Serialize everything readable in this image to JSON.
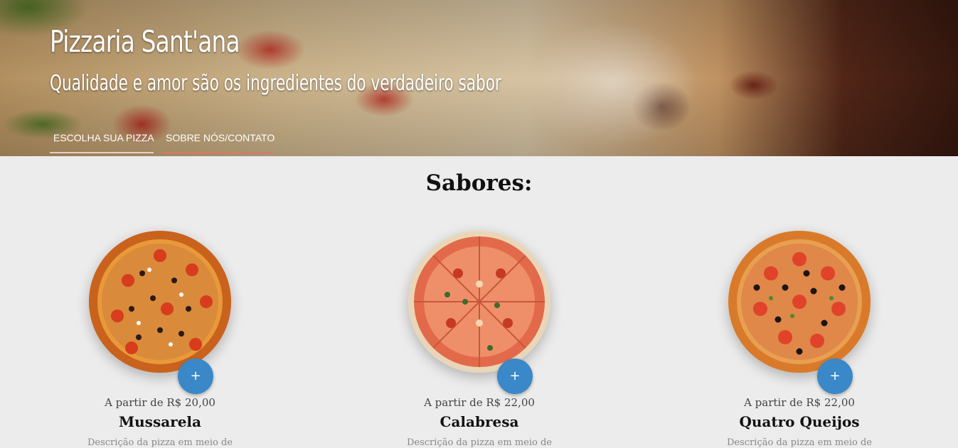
{
  "header": {
    "title": "Pizzaria Sant'ana",
    "tagline": "Qualidade e amor são os ingredientes do verdadeiro sabor",
    "nav": [
      {
        "label": "ESCOLHA SUA PIZZA"
      },
      {
        "label": "SOBRE NÓS/CONTATO"
      }
    ]
  },
  "main": {
    "section_title": "Sabores:",
    "pizzas": [
      {
        "name": "Mussarela",
        "price": "A partir de R$ 20,00",
        "add_label": "+",
        "description": "Descrição da pizza em meio de",
        "image": "pizza-mussarela-image"
      },
      {
        "name": "Calabresa",
        "price": "A partir de R$ 22,00",
        "add_label": "+",
        "description": "Descrição da pizza em meio de",
        "image": "pizza-calabresa-image"
      },
      {
        "name": "Quatro Queijos",
        "price": "A partir de R$ 22,00",
        "add_label": "+",
        "description": "Descrição da pizza em meio de",
        "image": "pizza-quatro-queijos-image"
      }
    ]
  },
  "colors": {
    "accent": "#3a88c8",
    "background": "#ececec",
    "nav_underline_active": "#e9cfc6",
    "nav_underline": "#d9776a"
  }
}
